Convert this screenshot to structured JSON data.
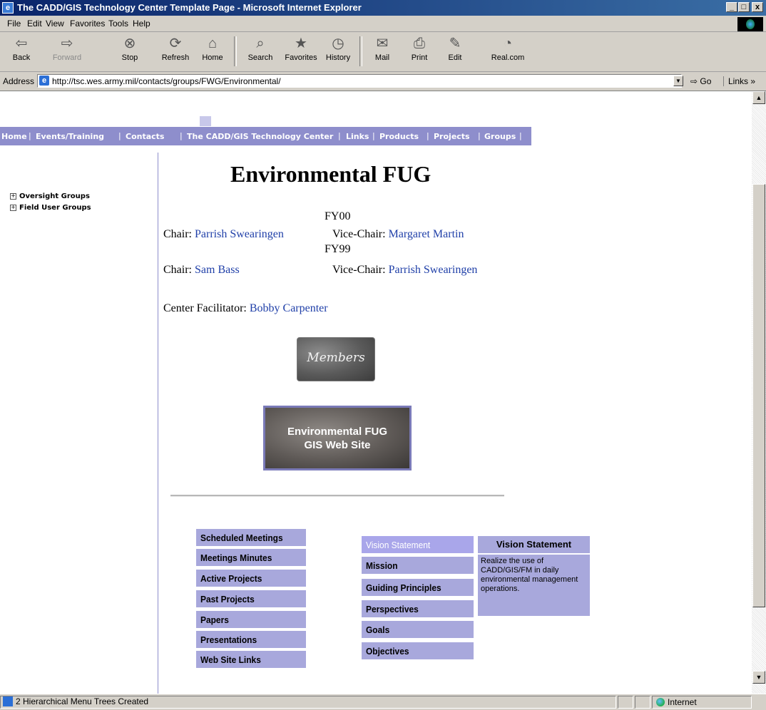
{
  "window": {
    "title": "The CADD/GIS Technology Center Template Page - Microsoft Internet Explorer",
    "controls": [
      "_",
      "□",
      "x"
    ]
  },
  "menubar": [
    "File",
    "Edit",
    "View",
    "Favorites",
    "Tools",
    "Help"
  ],
  "toolbar": [
    {
      "label": "Back",
      "icon": "back-arrow-icon"
    },
    {
      "label": "Forward",
      "icon": "forward-arrow-icon"
    },
    {
      "label": "Stop",
      "icon": "stop-icon"
    },
    {
      "label": "Refresh",
      "icon": "refresh-icon"
    },
    {
      "label": "Home",
      "icon": "home-icon"
    },
    {
      "label": "Search",
      "icon": "search-icon"
    },
    {
      "label": "Favorites",
      "icon": "favorites-icon"
    },
    {
      "label": "History",
      "icon": "history-icon"
    },
    {
      "label": "Mail",
      "icon": "mail-icon"
    },
    {
      "label": "Print",
      "icon": "print-icon"
    },
    {
      "label": "Edit",
      "icon": "edit-icon"
    },
    {
      "label": "Real.com",
      "icon": "realcom-icon"
    }
  ],
  "address": {
    "label": "Address",
    "url": "http://tsc.wes.army.mil/contacts/groups/FWG/Environmental/",
    "go": "Go",
    "links": "Links »"
  },
  "nav": [
    "Home",
    "Events/Training",
    "Contacts",
    "The CADD/GIS Technology Center",
    "Links",
    "Products",
    "Projects",
    "Groups"
  ],
  "tree": [
    "Oversight Groups",
    "Field User Groups"
  ],
  "page": {
    "title": "Environmental FUG",
    "fy00": "FY00",
    "fy99": "FY99",
    "chair_label": "Chair:",
    "vice_chair_label": "Vice-Chair:",
    "fy00_chair": "Parrish Swearingen",
    "fy00_vice": "Margaret Martin",
    "fy99_chair": "Sam Bass",
    "fy99_vice": "Parrish Swearingen",
    "facilitator_label": "Center Facilitator:",
    "facilitator": "Bobby Carpenter",
    "members_button": "Members",
    "gis_button_line1": "Environmental FUG",
    "gis_button_line2": "GIS Web Site"
  },
  "left_menu": [
    "Scheduled Meetings",
    "Meetings Minutes",
    "Active Projects",
    "Past Projects",
    "Papers",
    "Presentations",
    "Web Site Links"
  ],
  "right_menu": [
    "Vision Statement",
    "Mission",
    "Guiding Principles",
    "Perspectives",
    "Goals",
    "Objectives"
  ],
  "vision": {
    "heading": "Vision Statement",
    "text": "Realize the use of CADD/GIS/FM in daily environmental management operations."
  },
  "status": {
    "text": "2 Hierarchical Menu Trees Created",
    "zone": "Internet"
  },
  "colors": {
    "nav_bar": "#8e8ecc",
    "menu_item": "#a8a8dc",
    "link": "#1f3fa8",
    "title_bar": "#0a246a"
  }
}
